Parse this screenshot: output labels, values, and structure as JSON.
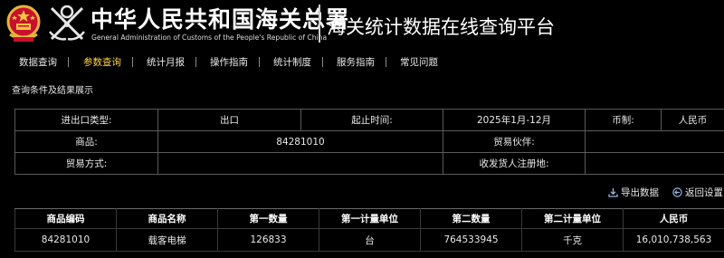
{
  "header": {
    "org_name_cn": "中华人民共和国海关总署",
    "org_name_en": "General Administration of Customs of the People's Republic of China",
    "platform_title": "海关统计数据在线查询平台"
  },
  "nav": {
    "items": [
      {
        "label": "数据查询"
      },
      {
        "label": "参数查询"
      },
      {
        "label": "统计月报"
      },
      {
        "label": "操作指南"
      },
      {
        "label": "统计制度"
      },
      {
        "label": "服务指南"
      },
      {
        "label": "常见问题"
      }
    ],
    "active_color": "#ffd23c"
  },
  "section_label": "查询条件及结果展示",
  "criteria": {
    "trade_type_label": "进出口类型:",
    "trade_type_value": "出口",
    "period_label": "起止时间:",
    "period_value": "2025年1月-12月",
    "currency_label": "币制:",
    "currency_value": "人民币",
    "commodity_label": "商品:",
    "commodity_value": "84281010",
    "partner_label": "贸易伙伴:",
    "partner_value": "",
    "trade_mode_label": "贸易方式:",
    "trade_mode_value": "",
    "registration_label": "收发货人注册地:",
    "registration_value": ""
  },
  "toolbar": {
    "export_label": "导出数据",
    "export_icon": "download-icon",
    "reset_label": "返回设置",
    "reset_icon": "back-arrow-icon"
  },
  "results": {
    "columns": [
      "商品编码",
      "商品名称",
      "第一数量",
      "第一计量单位",
      "第二数量",
      "第二计量单位",
      "人民币"
    ],
    "rows": [
      [
        "84281010",
        "载客电梯",
        "126833",
        "台",
        "764533945",
        "千克",
        "16,010,738,563"
      ]
    ]
  }
}
